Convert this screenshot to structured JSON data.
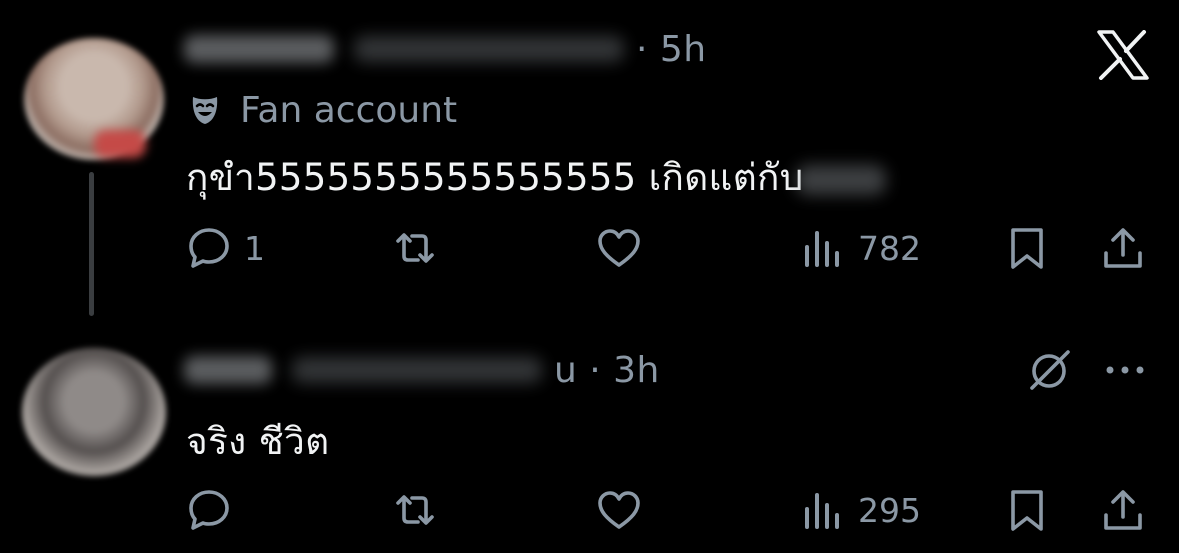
{
  "replies": [
    {
      "time": "· 5h",
      "label": "Fan account",
      "text": "กุขำ5555555555555555 เกิดแต่กับ",
      "actions": {
        "reply_count": "1",
        "views": "782"
      }
    },
    {
      "time": "u · 3h",
      "text": "จริง ชีวิต",
      "actions": {
        "reply_count": "",
        "views": "295"
      }
    }
  ],
  "icons": {
    "brand": "x-logo-icon",
    "reply": "reply-icon",
    "repost": "repost-icon",
    "like": "heart-icon",
    "views": "views-icon",
    "bookmark": "bookmark-icon",
    "share": "share-icon",
    "grok": "grok-icon",
    "more": "more-icon",
    "label": "masks-icon"
  },
  "colors": {
    "background": "#000000",
    "text": "#e7e9ea",
    "muted": "#8b98a5"
  }
}
